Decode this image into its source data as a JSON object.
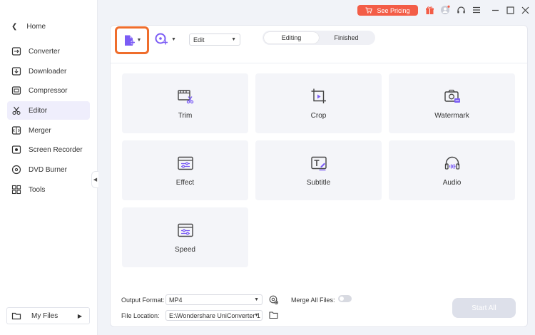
{
  "sidebar": {
    "home_label": "Home",
    "items": [
      {
        "label": "Converter",
        "icon": "converter-icon"
      },
      {
        "label": "Downloader",
        "icon": "downloader-icon"
      },
      {
        "label": "Compressor",
        "icon": "compressor-icon"
      },
      {
        "label": "Editor",
        "icon": "editor-icon",
        "active": true
      },
      {
        "label": "Merger",
        "icon": "merger-icon"
      },
      {
        "label": "Screen Recorder",
        "icon": "screen-recorder-icon"
      },
      {
        "label": "DVD Burner",
        "icon": "dvd-burner-icon"
      },
      {
        "label": "Tools",
        "icon": "tools-icon"
      }
    ],
    "my_files_label": "My Files"
  },
  "topbar": {
    "pricing_label": "See Pricing",
    "icons": [
      "gift-icon",
      "user-icon",
      "headset-icon",
      "menu-icon",
      "minimize-icon",
      "maximize-icon",
      "close-icon"
    ]
  },
  "toolbar": {
    "edit_select_value": "Edit",
    "tabs": [
      {
        "label": "Editing",
        "active": true
      },
      {
        "label": "Finished",
        "active": false
      }
    ]
  },
  "tools": [
    {
      "label": "Trim",
      "icon": "trim-icon"
    },
    {
      "label": "Crop",
      "icon": "crop-icon"
    },
    {
      "label": "Watermark",
      "icon": "watermark-icon"
    },
    {
      "label": "Effect",
      "icon": "effect-icon"
    },
    {
      "label": "Subtitle",
      "icon": "subtitle-icon"
    },
    {
      "label": "Audio",
      "icon": "audio-icon"
    },
    {
      "label": "Speed",
      "icon": "speed-icon"
    }
  ],
  "bottom": {
    "output_format_label": "Output Format:",
    "output_format_value": "MP4",
    "merge_label": "Merge All Files:",
    "merge_enabled": false,
    "file_location_label": "File Location:",
    "file_location_value": "E:\\Wondershare UniConverter 1",
    "start_all_label": "Start All"
  },
  "colors": {
    "accent": "#7b5cf5",
    "highlight_border": "#ef6d2c",
    "pricing_bg": "#f35d47",
    "active_nav_bg": "#efeefc"
  }
}
